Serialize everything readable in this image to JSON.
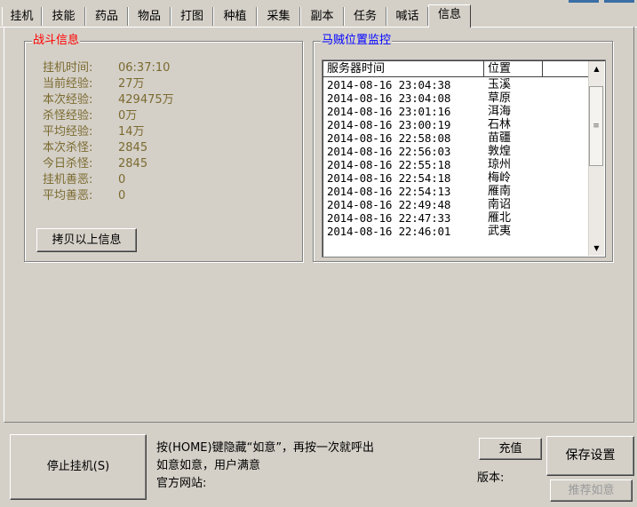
{
  "tabs": [
    "挂机",
    "技能",
    "药品",
    "物品",
    "打图",
    "种植",
    "采集",
    "副本",
    "任务",
    "喊话",
    "信息"
  ],
  "active_tab": "信息",
  "battle_info": {
    "title": "战斗信息",
    "stats": [
      {
        "label": "挂机时间:",
        "value": "06:37:10"
      },
      {
        "label": "当前经验:",
        "value": "27万"
      },
      {
        "label": "本次经验:",
        "value": "429475万"
      },
      {
        "label": "杀怪经验:",
        "value": "0万"
      },
      {
        "label": "平均经验:",
        "value": "14万"
      },
      {
        "label": "本次杀怪:",
        "value": "2845"
      },
      {
        "label": "今日杀怪:",
        "value": "2845"
      },
      {
        "label": "挂机善恶:",
        "value": "0"
      },
      {
        "label": "平均善恶:",
        "value": "0"
      }
    ],
    "copy_button": "拷贝以上信息"
  },
  "monitor": {
    "title": "马贼位置监控",
    "columns": [
      "服务器时间",
      "位置",
      ""
    ],
    "rows": [
      {
        "time": "2014-08-16 23:04:38",
        "place": "玉溪"
      },
      {
        "time": "2014-08-16 23:04:08",
        "place": "草原"
      },
      {
        "time": "2014-08-16 23:01:16",
        "place": "洱海"
      },
      {
        "time": "2014-08-16 23:00:19",
        "place": "石林"
      },
      {
        "time": "2014-08-16 22:58:08",
        "place": "苗疆"
      },
      {
        "time": "2014-08-16 22:56:03",
        "place": "敦煌"
      },
      {
        "time": "2014-08-16 22:55:18",
        "place": "琼州"
      },
      {
        "time": "2014-08-16 22:54:18",
        "place": "梅岭"
      },
      {
        "time": "2014-08-16 22:54:13",
        "place": "雁南"
      },
      {
        "time": "2014-08-16 22:49:48",
        "place": "南诏"
      },
      {
        "time": "2014-08-16 22:47:33",
        "place": "雁北"
      },
      {
        "time": "2014-08-16 22:46:01",
        "place": "武夷"
      }
    ]
  },
  "bottom": {
    "stop_button": "停止挂机(S)",
    "tip_lines": [
      "按(HOME)键隐藏“如意”，再按一次就呼出",
      "如意如意，用户满意",
      "官方网站:"
    ],
    "recharge_button": "充值",
    "version_label": "版本:",
    "save_button": "保存设置",
    "recommend_button": "推荐如意"
  }
}
